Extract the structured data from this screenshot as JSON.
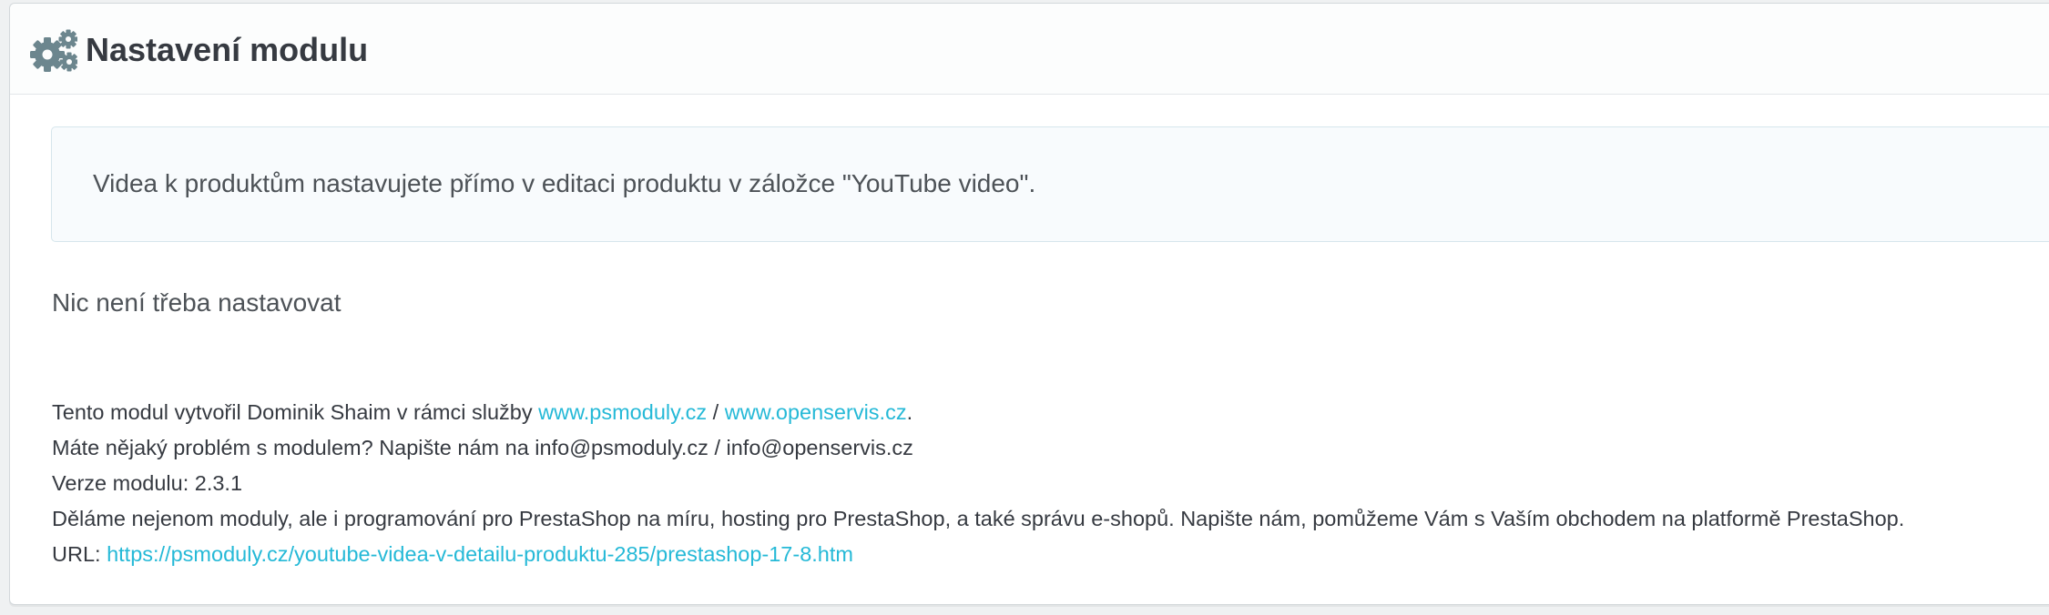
{
  "header": {
    "title": "Nastavení modulu",
    "icon": "gears-icon"
  },
  "alert": {
    "text": "Videa k produktům nastavujete přímo v editaci produktu v záložce \"YouTube video\"."
  },
  "status": {
    "text": "Nic není třeba nastavovat"
  },
  "footer": {
    "line1_prefix": "Tento modul vytvořil Dominik Shaim v rámci služby ",
    "link1": "www.psmoduly.cz",
    "separator": " / ",
    "link2": "www.openservis.cz",
    "line1_suffix": ".",
    "line2": "Máte nějaký problém s modulem? Napište nám na info@psmoduly.cz / info@openservis.cz",
    "line3": "Verze modulu: 2.3.1",
    "line4": "Děláme nejenom moduly, ale i programování pro PrestaShop na míru, hosting pro PrestaShop, a také správu e-shopů. Napište nám, pomůžeme Vám s Vaším obchodem na platformě PrestaShop.",
    "url_label": "URL: ",
    "url": "https://psmoduly.cz/youtube-videa-v-detailu-produktu-285/prestashop-17-8.htm"
  },
  "colors": {
    "link": "#25b9d7",
    "icon": "#6c868e",
    "text": "#363a41"
  }
}
